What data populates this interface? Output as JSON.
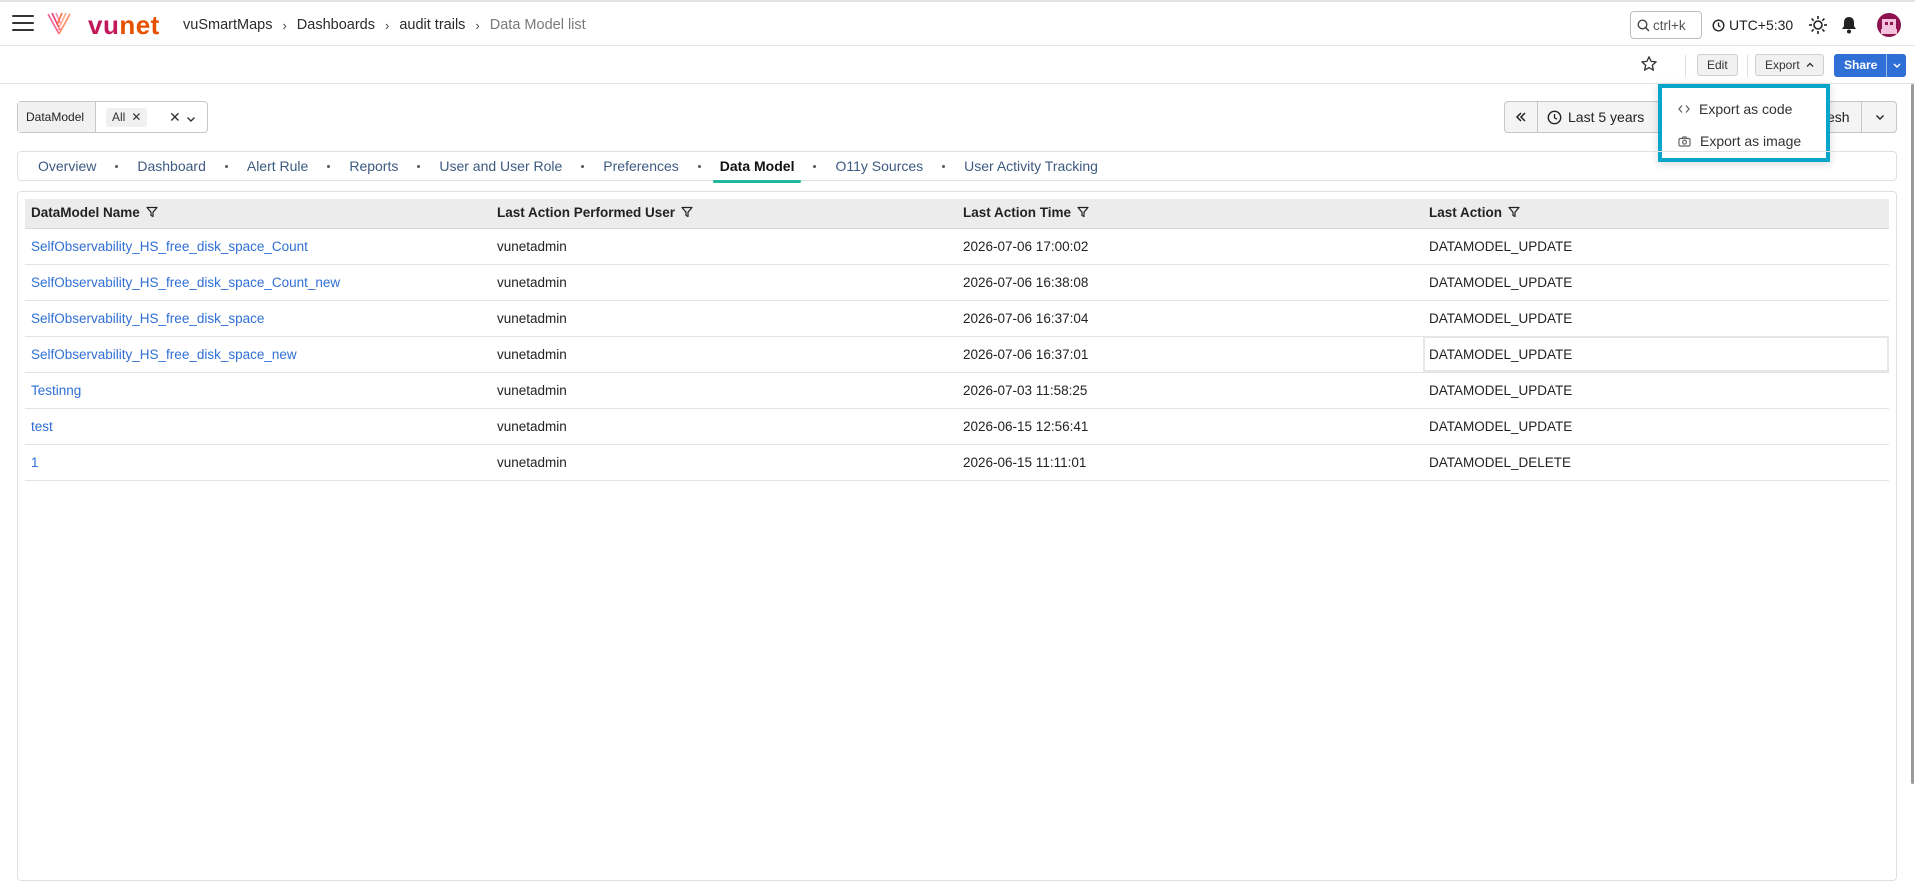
{
  "brand": {
    "name_v": "vu",
    "name_n": "net"
  },
  "breadcrumb": [
    "vuSmartMaps",
    "Dashboards",
    "audit trails",
    "Data Model list"
  ],
  "search": {
    "hint": "ctrl+k"
  },
  "timezone": "UTC+5:30",
  "toolbar": {
    "edit": "Edit",
    "export": "Export",
    "share": "Share"
  },
  "export_menu": {
    "code": "Export as code",
    "image": "Export as image"
  },
  "filter": {
    "label": "DataModel",
    "chip": "All"
  },
  "timebar": {
    "range": "Last 5 years",
    "refresh": "esh"
  },
  "tabs": [
    "Overview",
    "Dashboard",
    "Alert Rule",
    "Reports",
    "User and User Role",
    "Preferences",
    "Data Model",
    "O11y Sources",
    "User Activity Tracking"
  ],
  "table": {
    "headers": [
      "DataModel Name",
      "Last Action Performed User",
      "Last Action Time",
      "Last Action"
    ],
    "rows": [
      [
        "SelfObservability_HS_free_disk_space_Count",
        "vunetadmin",
        "2026-07-06 17:00:02",
        "DATAMODEL_UPDATE"
      ],
      [
        "SelfObservability_HS_free_disk_space_Count_new",
        "vunetadmin",
        "2026-07-06 16:38:08",
        "DATAMODEL_UPDATE"
      ],
      [
        "SelfObservability_HS_free_disk_space",
        "vunetadmin",
        "2026-07-06 16:37:04",
        "DATAMODEL_UPDATE"
      ],
      [
        "SelfObservability_HS_free_disk_space_new",
        "vunetadmin",
        "2026-07-06 16:37:01",
        "DATAMODEL_UPDATE"
      ],
      [
        "Testinng",
        "vunetadmin",
        "2026-07-03 11:58:25",
        "DATAMODEL_UPDATE"
      ],
      [
        "test",
        "vunetadmin",
        "2026-06-15 12:56:41",
        "DATAMODEL_UPDATE"
      ],
      [
        "1",
        "vunetadmin",
        "2026-06-15 11:11:01",
        "DATAMODEL_DELETE"
      ]
    ]
  }
}
